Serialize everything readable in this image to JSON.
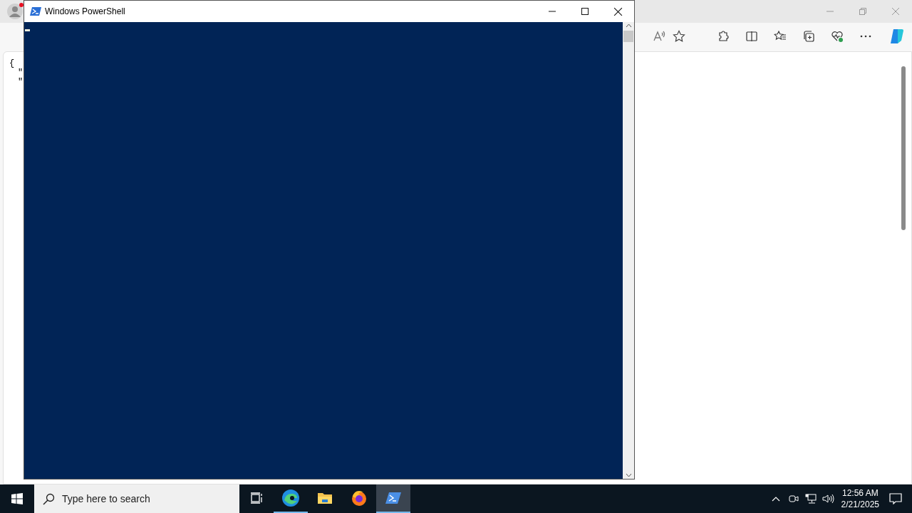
{
  "browser": {
    "content_lines": [
      "{",
      "\"",
      "\""
    ],
    "has_notification": true
  },
  "powershell": {
    "title": "Windows PowerShell",
    "cursor_visible": true
  },
  "taskbar": {
    "search": {
      "placeholder": "Type here to search"
    },
    "apps": [
      {
        "kind": "taskview",
        "running": false,
        "selected": false
      },
      {
        "kind": "edge",
        "running": true,
        "selected": false
      },
      {
        "kind": "explorer",
        "running": false,
        "selected": false
      },
      {
        "kind": "firefox",
        "running": false,
        "selected": false
      },
      {
        "kind": "powershell",
        "running": true,
        "selected": true
      }
    ],
    "time": "12:56 AM",
    "date": "2/21/2025"
  }
}
